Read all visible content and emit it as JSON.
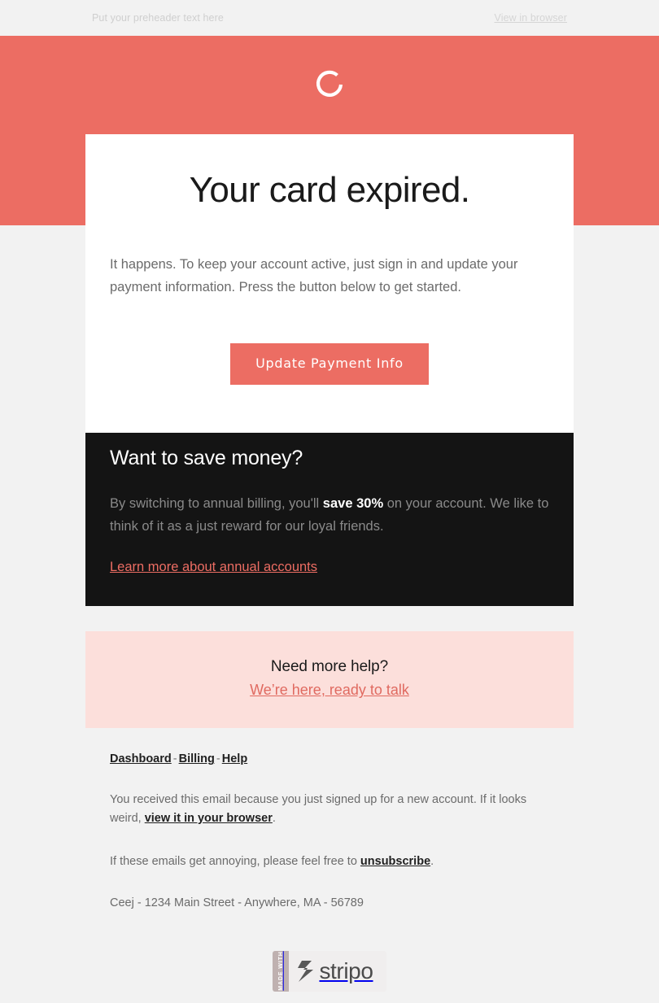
{
  "colors": {
    "brand_salmon": "#ec6d63",
    "page_bg": "#f2f2f2",
    "card_bg": "#ffffff",
    "dark_bg": "#141414",
    "help_pink_bg": "#fcdfdb",
    "link_red": "#e06a60"
  },
  "preheader": {
    "text": "Put your preheader text here",
    "view_in_browser": "View in browser"
  },
  "hero": {
    "logo_name": "ring-logo"
  },
  "card": {
    "title": "Your card expired.",
    "body": "It happens. To keep your account active, just sign in and update your payment information. Press the button below to get started.",
    "cta_label": "Update Payment Info"
  },
  "savings": {
    "title": "Want to save money?",
    "body_before": "By switching to annual billing, you'll ",
    "body_bold": "save 30%",
    "body_after": " on your account. We like to think of it as a just reward for our loyal friends.",
    "link": "Learn more about annual accounts"
  },
  "help": {
    "title": "Need more help?",
    "link": "We’re here, ready to talk"
  },
  "footer": {
    "nav": {
      "dashboard": "Dashboard",
      "billing": "Billing",
      "help": "Help",
      "separator": "-"
    },
    "signup_before": "You received this email because you just signed up for a new account. If it looks weird, ",
    "signup_link": "view it in your browser",
    "signup_after": ".",
    "unsubscribe_before": "If these emails get annoying, please feel free to ",
    "unsubscribe_link": "unsubscribe",
    "unsubscribe_after": ".",
    "address": "Ceej - 1234 Main Street - Anywhere, MA - 56789"
  },
  "badge": {
    "ribbon": "MADE WITH",
    "word": "stripo"
  }
}
